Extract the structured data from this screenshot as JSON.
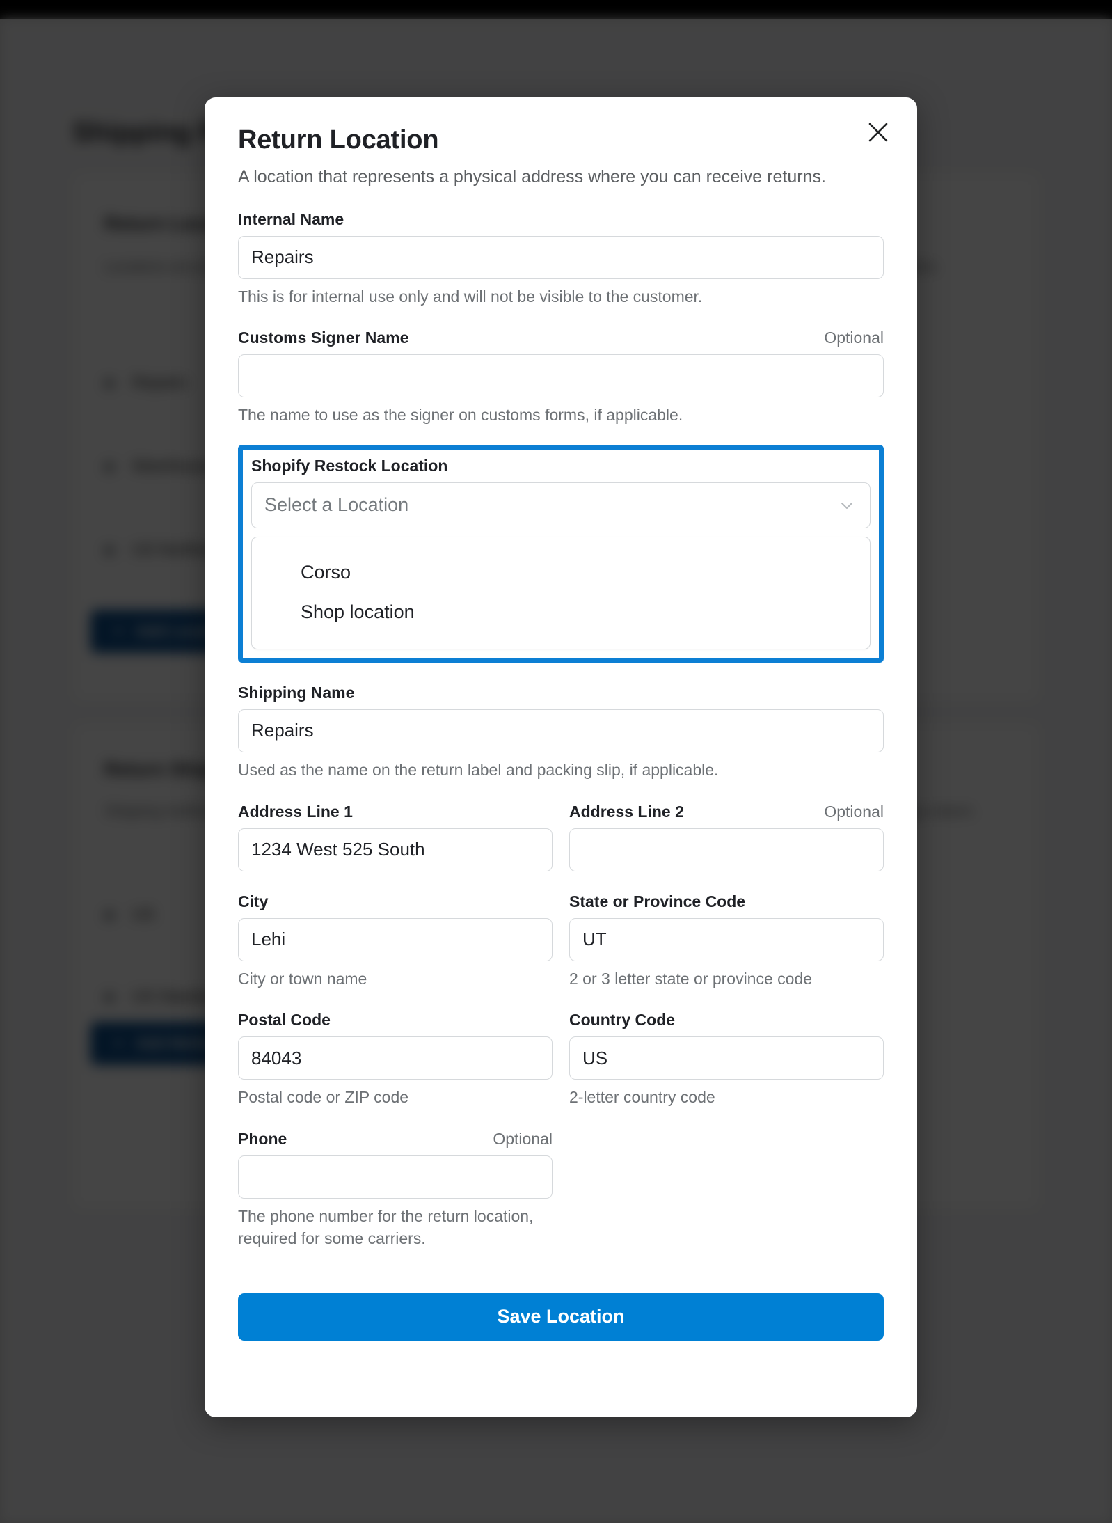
{
  "background": {
    "page_title": "Shipping Policies",
    "card1": {
      "title": "Return Locations",
      "description": "Locations are physical addresses where you can receive returns. You can set up multiple locations with shipping to each location.",
      "rows": [
        "Repairs",
        "Warehouse",
        "US Northeast"
      ],
      "button_label": "Add Location"
    },
    "card2": {
      "title": "Return Shipping",
      "description": "Shipping methods define how a return is shipped back to you. These are the options presented to the customer when creating a return.",
      "rows": [
        "US",
        "US Standard"
      ],
      "button_label": "Add Method"
    }
  },
  "modal": {
    "title": "Return Location",
    "subtitle": "A location that represents a physical address where you can receive returns.",
    "close_icon": "close-icon",
    "optional_label": "Optional",
    "fields": {
      "internal_name": {
        "label": "Internal Name",
        "value": "Repairs",
        "placeholder": "",
        "help": "This is for internal use only and will not be visible to the customer."
      },
      "customs_signer_name": {
        "label": "Customs Signer Name",
        "value": "",
        "placeholder": "",
        "optional": "Optional",
        "help": "The name to use as the signer on customs forms, if applicable."
      },
      "shopify_restock_location": {
        "label": "Shopify Restock Location",
        "selected": "Select a Location",
        "chevron_icon": "chevron-down-icon",
        "options": [
          "Corso",
          "Shop location"
        ]
      },
      "shipping_name": {
        "label": "Shipping Name",
        "value": "Repairs",
        "placeholder": "",
        "help": "Used as the name on the return label and packing slip, if applicable."
      },
      "address_line_1": {
        "label": "Address Line 1",
        "value": "1234 West 525 South",
        "placeholder": "",
        "help": ""
      },
      "address_line_2": {
        "label": "Address Line 2",
        "value": "",
        "placeholder": "",
        "optional": "Optional",
        "help": ""
      },
      "city": {
        "label": "City",
        "value": "Lehi",
        "placeholder": "",
        "help": "City or town name"
      },
      "state_or_province_code": {
        "label": "State or Province Code",
        "value": "UT",
        "placeholder": "",
        "help": "2 or 3 letter state or province code"
      },
      "postal_code": {
        "label": "Postal Code",
        "value": "84043",
        "placeholder": "",
        "help": "Postal code or ZIP code"
      },
      "country_code": {
        "label": "Country Code",
        "value": "US",
        "placeholder": "",
        "help": "2-letter country code"
      },
      "phone": {
        "label": "Phone",
        "value": "",
        "placeholder": "",
        "optional": "Optional",
        "help": "The phone number for the return location, required for some carriers."
      }
    },
    "save_button": "Save Location"
  },
  "colors": {
    "accent_blue": "#0080d4",
    "highlight_blue": "#0c7fd4",
    "overlay": "#3a3a3a"
  }
}
